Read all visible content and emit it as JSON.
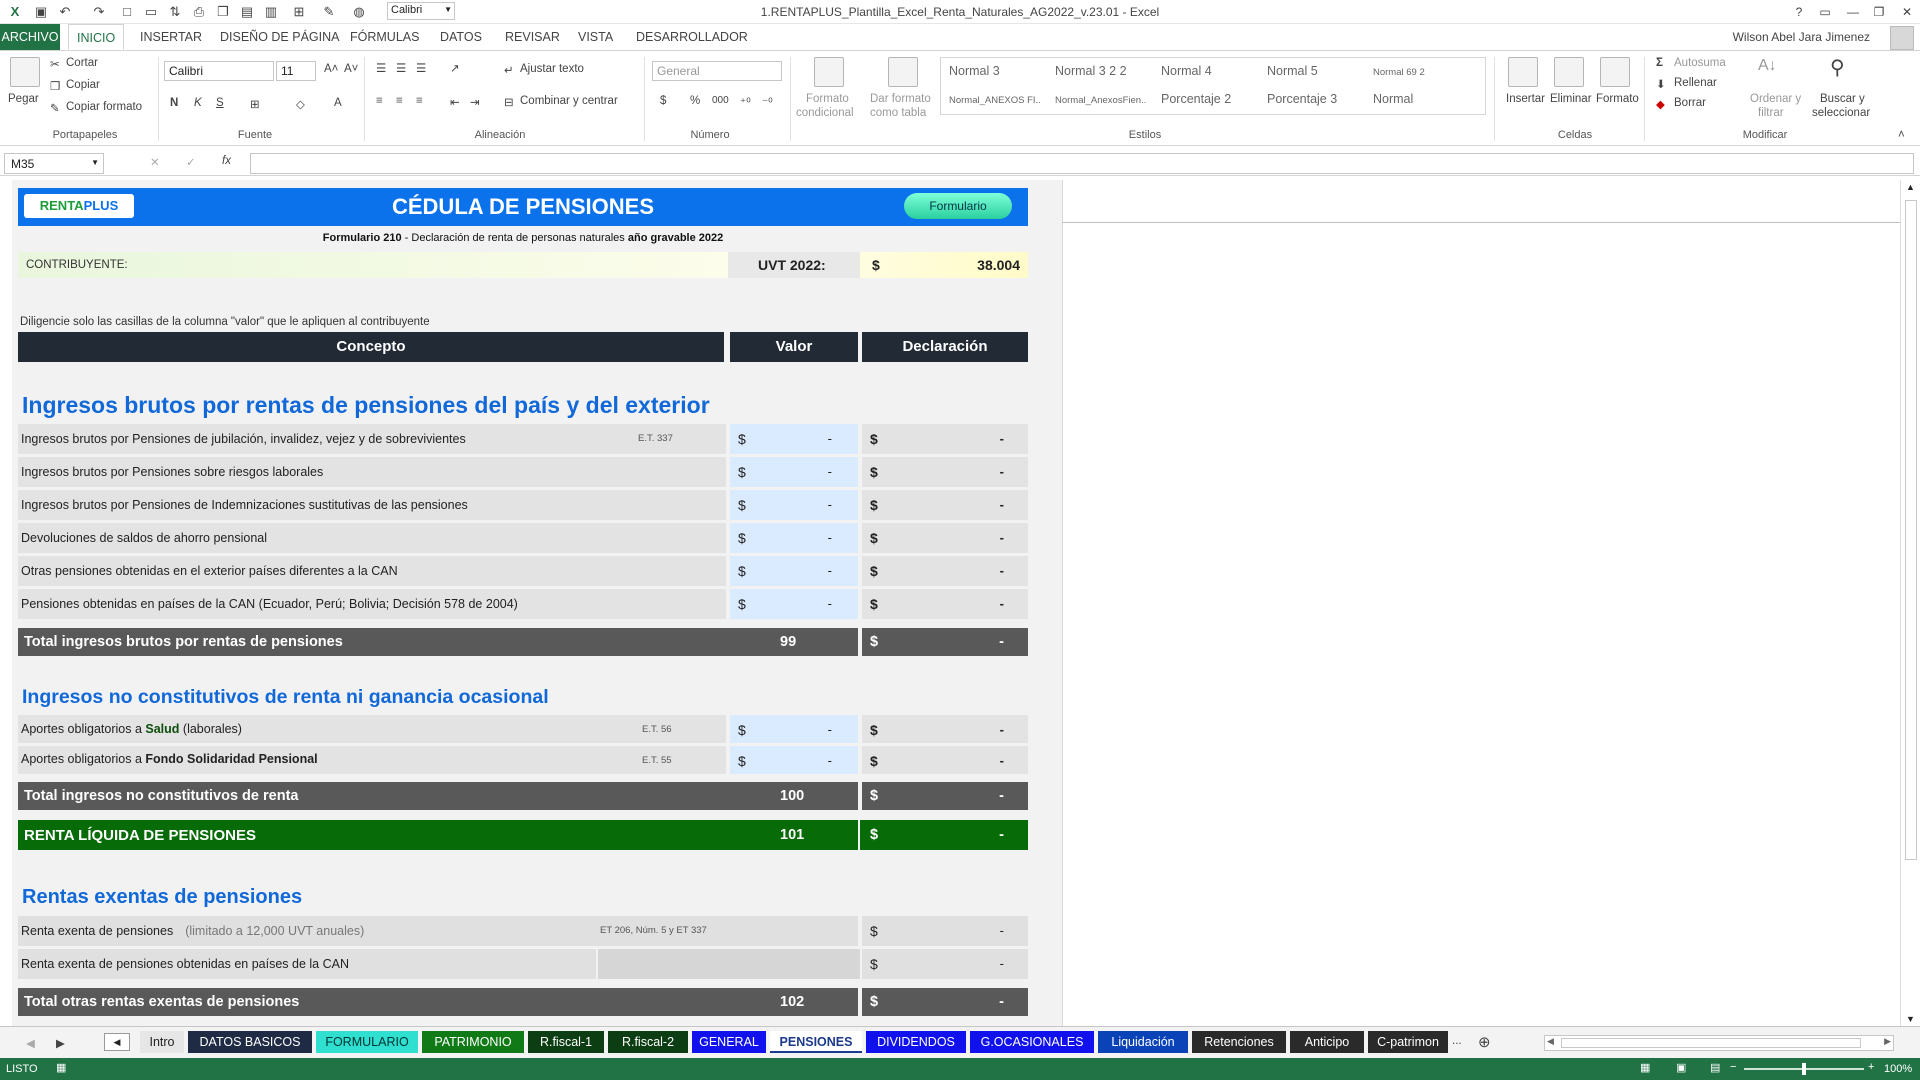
{
  "window": {
    "title": "1.RENTAPLUS_Plantilla_Excel_Renta_Naturales_AG2022_v.23.01 - Excel",
    "user": "Wilson Abel Jara Jimenez"
  },
  "quick_access": {
    "font_name": "Calibri"
  },
  "menu": [
    "ARCHIVO",
    "INICIO",
    "INSERTAR",
    "DISEÑO DE PÁGINA",
    "FÓRMULAS",
    "DATOS",
    "REVISAR",
    "VISTA",
    "DESARROLLADOR"
  ],
  "ribbon": {
    "clipboard": {
      "paste": "Pegar",
      "cut": "Cortar",
      "copy": "Copiar",
      "format_painter": "Copiar formato",
      "group": "Portapapeles"
    },
    "font": {
      "name": "Calibri",
      "size": "11",
      "bold": "N",
      "italic": "K",
      "underline": "S",
      "group": "Fuente"
    },
    "alignment": {
      "wrap": "Ajustar texto",
      "merge": "Combinar y centrar",
      "group": "Alineación"
    },
    "number": {
      "format": "General",
      "group": "Número",
      "percent": "%",
      "thousands": "000"
    },
    "styles": {
      "cond1": "Formato",
      "cond2": "condicional",
      "table1": "Dar formato",
      "table2": "como tabla",
      "group": "Estilos",
      "cells": [
        "Normal 3",
        "Normal 3 2 2",
        "Normal 4",
        "Normal 5",
        "Normal 69 2",
        "Normal_ANEXOS FI...",
        "Normal_AnexosFien...",
        "Porcentaje 2",
        "Porcentaje 3",
        "Normal"
      ]
    },
    "cells": {
      "insert": "Insertar",
      "delete": "Eliminar",
      "format": "Formato",
      "group": "Celdas"
    },
    "editing": {
      "autosum": "Autosuma",
      "fill": "Rellenar",
      "clear": "Borrar",
      "sort1": "Ordenar y",
      "sort2": "filtrar",
      "find1": "Buscar y",
      "find2": "seleccionar",
      "group": "Modificar"
    }
  },
  "formula_bar": {
    "name_box": "M35",
    "fx": "fx",
    "value": ""
  },
  "sheet": {
    "logo_a": "RENTA",
    "logo_b": "PLUS",
    "title": "CÉDULA DE PENSIONES",
    "form_button": "Formulario",
    "subtitle_a": "Formulario 210",
    "subtitle_b": " - Declaración de renta de personas naturales ",
    "subtitle_c": "año gravable 2022",
    "contrib_label": "CONTRIBUYENTE:",
    "uvt_label": "UVT 2022:",
    "uvt_currency": "$",
    "uvt_value": "38.004",
    "instruction": "Diligencie solo las casillas de la columna \"valor\" que le apliquen al contribuyente",
    "headers": [
      "Concepto",
      "Valor",
      "Declaración"
    ],
    "section1": "Ingresos brutos por rentas de pensiones del país y del exterior",
    "rows1": [
      {
        "label": "Ingresos brutos por Pensiones de jubilación, invalidez, vejez y de sobrevivientes",
        "ref": "E.T. 337"
      },
      {
        "label": "Ingresos brutos por Pensiones sobre riesgos laborales",
        "ref": ""
      },
      {
        "label": "Ingresos brutos por Pensiones de Indemnizaciones sustitutivas de las pensiones",
        "ref": ""
      },
      {
        "label": "Devoluciones de saldos de ahorro pensional",
        "ref": ""
      },
      {
        "label": "Otras pensiones obtenidas en el exterior países diferentes a la CAN",
        "ref": ""
      },
      {
        "label": "Pensiones obtenidas en países de la CAN (Ecuador, Perú; Bolivia; Decisión 578 de 2004)",
        "ref": ""
      }
    ],
    "total1": {
      "label": "Total ingresos brutos por rentas de pensiones",
      "num": "99"
    },
    "section2": "Ingresos no constitutivos de renta ni ganancia ocasional",
    "rows2": [
      {
        "pre": "Aportes obligatorios a ",
        "bold": "Salud",
        "post": " (laborales)",
        "ref": "E.T. 56"
      },
      {
        "pre": "Aportes obligatorios a ",
        "bold": "Fondo Solidaridad Pensional",
        "post": "",
        "ref": "E.T. 55"
      }
    ],
    "total2": {
      "label": "Total ingresos no constitutivos de renta",
      "num": "100"
    },
    "total3": {
      "label": "RENTA LÍQUIDA DE PENSIONES",
      "num": "101"
    },
    "section3": "Rentas exentas de pensiones",
    "rows3": [
      {
        "label": "Renta exenta de pensiones",
        "note": "(limitado a 12,000 UVT anuales)",
        "ref": "ET 206, Núm. 5 y ET 337"
      },
      {
        "label": "Renta exenta de pensiones obtenidas en países de la CAN",
        "note": "",
        "ref": ""
      }
    ],
    "total4": {
      "label": "Total otras rentas exentas de pensiones",
      "num": "102"
    },
    "currency": "$",
    "dash": "-"
  },
  "sheet_tabs": [
    {
      "label": "Intro",
      "bg": "#e6e6e6",
      "fg": "#222"
    },
    {
      "label": "DATOS BASICOS",
      "bg": "#1f2a44",
      "fg": "#fff"
    },
    {
      "label": "FORMULARIO",
      "bg": "#2fe0d0",
      "fg": "#033"
    },
    {
      "label": "PATRIMONIO",
      "bg": "#0f7a16",
      "fg": "#fff"
    },
    {
      "label": "R.fiscal-1",
      "bg": "#0d3d12",
      "fg": "#fff"
    },
    {
      "label": "R.fiscal-2",
      "bg": "#0d3d12",
      "fg": "#fff"
    },
    {
      "label": "GENERAL",
      "bg": "#1111ee",
      "fg": "#fff"
    },
    {
      "label": "PENSIONES",
      "bg": "#ffffff",
      "fg": "#1b3a8c"
    },
    {
      "label": "DIVIDENDOS",
      "bg": "#1111ee",
      "fg": "#fff"
    },
    {
      "label": "G.OCASIONALES",
      "bg": "#1111ee",
      "fg": "#fff"
    },
    {
      "label": "Liquidación",
      "bg": "#0a43b8",
      "fg": "#fff"
    },
    {
      "label": "Retenciones",
      "bg": "#2a2a2a",
      "fg": "#fff"
    },
    {
      "label": "Anticipo",
      "bg": "#2a2a2a",
      "fg": "#fff"
    },
    {
      "label": "C-patrimon",
      "bg": "#2a2a2a",
      "fg": "#fff"
    }
  ],
  "tab_more": "...",
  "status": {
    "ready": "LISTO",
    "zoom": "100%"
  }
}
